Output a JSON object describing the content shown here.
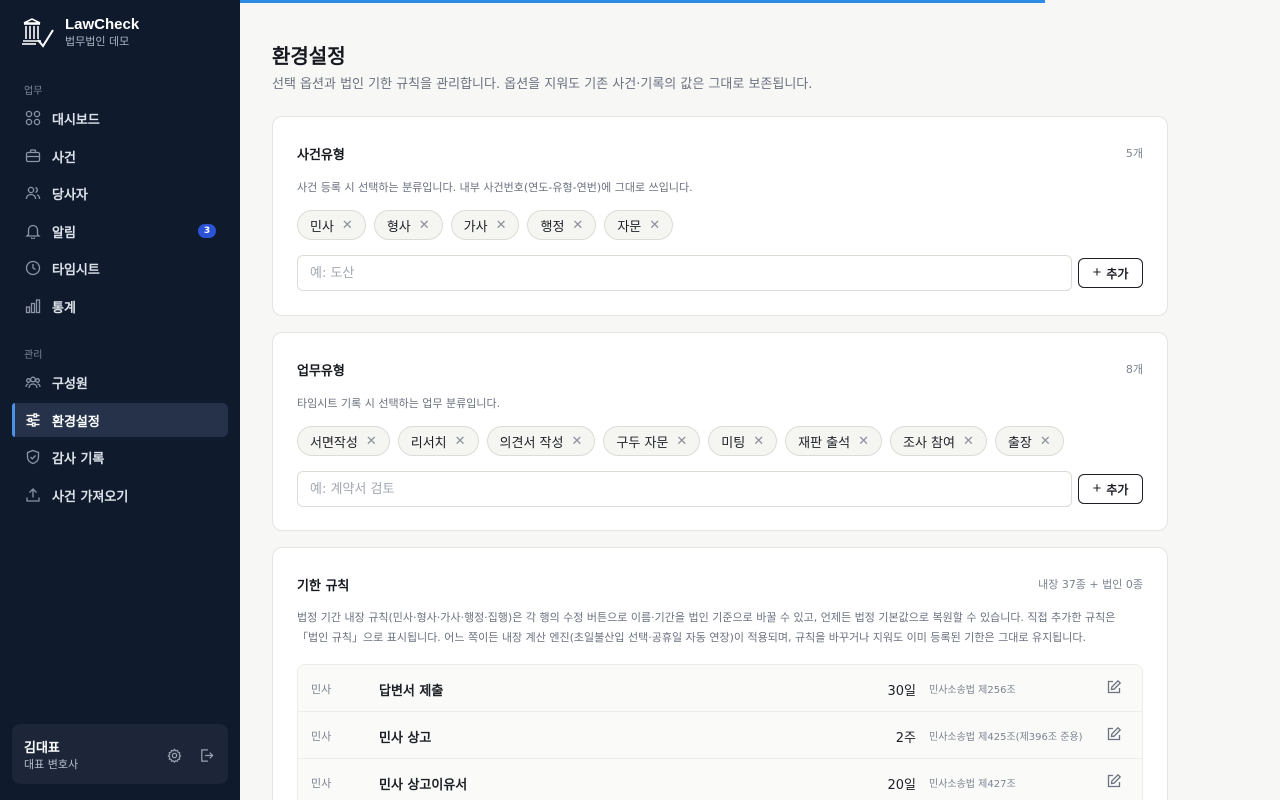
{
  "brand": {
    "name": "LawCheck",
    "subtitle": "법무법인 데모"
  },
  "nav": {
    "section_work": "업무",
    "section_admin": "관리",
    "work_items": [
      {
        "label": "대시보드",
        "icon": "grid-icon"
      },
      {
        "label": "사건",
        "icon": "briefcase-icon"
      },
      {
        "label": "당사자",
        "icon": "users-icon"
      },
      {
        "label": "알림",
        "icon": "bell-icon",
        "badge": "3"
      },
      {
        "label": "타임시트",
        "icon": "clock-icon"
      },
      {
        "label": "통계",
        "icon": "bar-chart-icon"
      }
    ],
    "admin_items": [
      {
        "label": "구성원",
        "icon": "members-icon"
      },
      {
        "label": "환경설정",
        "icon": "sliders-icon",
        "active": true
      },
      {
        "label": "감사 기록",
        "icon": "shield-icon"
      },
      {
        "label": "사건 가져오기",
        "icon": "upload-icon"
      }
    ]
  },
  "user": {
    "name": "김대표",
    "role": "대표 변호사"
  },
  "page": {
    "title": "환경설정",
    "description": "선택 옵션과 법인 기한 규칙을 관리합니다. 옵션을 지워도 기존 사건·기록의 값은 그대로 보존됩니다."
  },
  "case_types": {
    "title": "사건유형",
    "count": "5개",
    "description": "사건 등록 시 선택하는 분류입니다. 내부 사건번호(연도-유형-연번)에 그대로 쓰입니다.",
    "items": [
      "민사",
      "형사",
      "가사",
      "행정",
      "자문"
    ],
    "placeholder": "예: 도산",
    "add_label": "추가"
  },
  "work_types": {
    "title": "업무유형",
    "count": "8개",
    "description": "타임시트 기록 시 선택하는 업무 분류입니다.",
    "items": [
      "서면작성",
      "리서치",
      "의견서 작성",
      "구두 자문",
      "미팅",
      "재판 출석",
      "조사 참여",
      "출장"
    ],
    "placeholder": "예: 계약서 검토",
    "add_label": "추가"
  },
  "deadline_rules": {
    "title": "기한 규칙",
    "count": "내장 37종 + 법인 0종",
    "description_line1": "법정 기간 내장 규칙(민사·형사·가사·행정·집행)은 각 행의 수정 버튼으로 이름·기간을 법인 기준으로 바꿀 수 있고, 언제든 법정 기본값으로 복원할 수 있습니다. 직접 추가한 규칙은",
    "description_line2": "「법인 규칙」으로 표시됩니다. 어느 쪽이든 내장 계산 엔진(초일불산입 선택·공휴일 자동 연장)이 적용되며, 규칙을 바꾸거나 지워도 이미 등록된 기한은 그대로 유지됩니다.",
    "rows": [
      {
        "category": "민사",
        "name": "답변서 제출",
        "period": "30일",
        "law": "민사소송법 제256조"
      },
      {
        "category": "민사",
        "name": "민사 상고",
        "period": "2주",
        "law": "민사소송법 제425조(제396조 준용)"
      },
      {
        "category": "민사",
        "name": "민사 상고이유서",
        "period": "20일",
        "law": "민사소송법 제427조"
      }
    ]
  }
}
